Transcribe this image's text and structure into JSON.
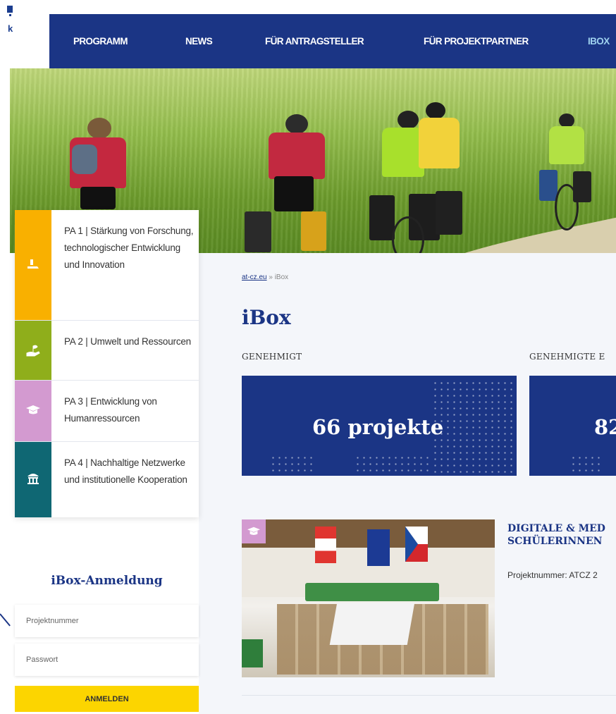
{
  "nav": {
    "items": [
      {
        "label": "PROGRAMM"
      },
      {
        "label": "NEWS"
      },
      {
        "label": "FÜR ANTRAGSTELLER"
      },
      {
        "label": "FÜR PROJEKTPARTNER"
      },
      {
        "label": "IBOX"
      }
    ],
    "logo_text": "k"
  },
  "priority_axes": [
    {
      "label": "PA 1 | Stärkung von Forschung, technologischer Entwicklung und Innovation",
      "color": "#f9b000",
      "icon": "hand-icon"
    },
    {
      "label": "PA 2 | Umwelt und Ressourcen",
      "color": "#8fae1b",
      "icon": "plant-hand-icon"
    },
    {
      "label": "PA 3 | Entwicklung von Humanressourcen",
      "color": "#d39ad0",
      "icon": "graduation-cap-icon"
    },
    {
      "label": "PA 4 | Nachhaltige Netzwerke und institutionelle Kooperation",
      "color": "#0f6773",
      "icon": "institution-icon"
    }
  ],
  "breadcrumb": {
    "home": "at-cz.eu",
    "separator": " » ",
    "current": "iBox"
  },
  "page_title": "iBox",
  "stats": [
    {
      "label": "GENEHMIGT",
      "value": "66  projekte"
    },
    {
      "label": "GENEHMIGTE E",
      "value": "82"
    }
  ],
  "project": {
    "title_line1": "DIGITALE & MED",
    "title_line2": "SCHÜLERINNEN",
    "meta": "Projektnummer: ATCZ 2"
  },
  "login": {
    "title": "iBox-Anmeldung",
    "project_placeholder": "Projektnummer",
    "password_placeholder": "Passwort",
    "button": "ANMELDEN"
  },
  "colors": {
    "brand": "#1b3585",
    "accent_yellow": "#fcd500"
  }
}
